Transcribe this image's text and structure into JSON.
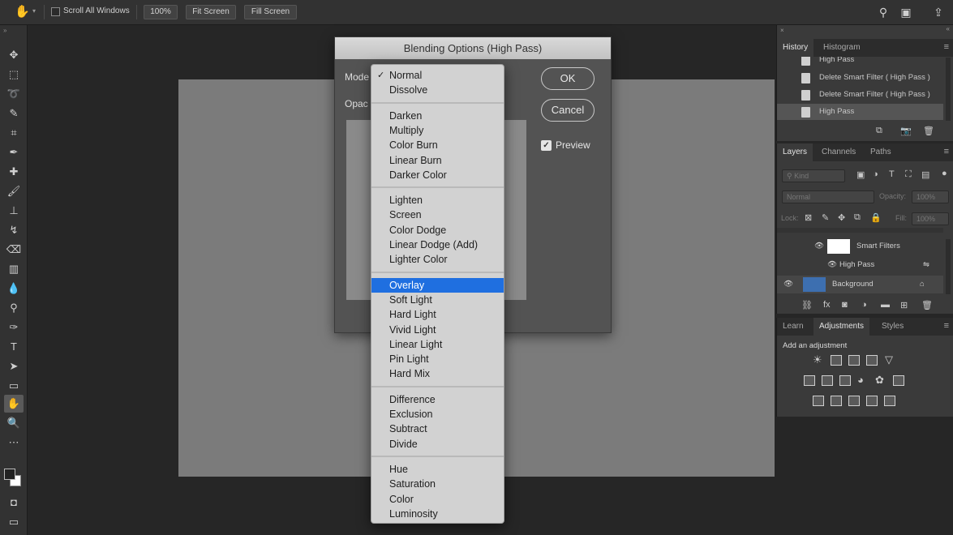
{
  "options_bar": {
    "scroll_all_windows_label": "Scroll All Windows",
    "zoom_value": "100%",
    "fit_screen_label": "Fit Screen",
    "fill_screen_label": "Fill Screen"
  },
  "dialog": {
    "title": "Blending Options (High Pass)",
    "mode_label": "Mode",
    "opacity_label": "Opac",
    "ok_label": "OK",
    "cancel_label": "Cancel",
    "preview_label": "Preview",
    "preview_checked": true
  },
  "blend_menu": {
    "selected": "Overlay",
    "checked": "Normal",
    "groups": [
      [
        "Normal",
        "Dissolve"
      ],
      [
        "Darken",
        "Multiply",
        "Color Burn",
        "Linear Burn",
        "Darker Color"
      ],
      [
        "Lighten",
        "Screen",
        "Color Dodge",
        "Linear Dodge (Add)",
        "Lighter Color"
      ],
      [
        "Overlay",
        "Soft Light",
        "Hard Light",
        "Vivid Light",
        "Linear Light",
        "Pin Light",
        "Hard Mix"
      ],
      [
        "Difference",
        "Exclusion",
        "Subtract",
        "Divide"
      ],
      [
        "Hue",
        "Saturation",
        "Color",
        "Luminosity"
      ]
    ]
  },
  "history_panel": {
    "tabs": [
      "History",
      "Histogram"
    ],
    "items": [
      "High Pass",
      "Delete Smart Filter ( High Pass )",
      "Delete Smart Filter ( High Pass )",
      "High Pass"
    ]
  },
  "layers_panel": {
    "tabs": [
      "Layers",
      "Channels",
      "Paths"
    ],
    "kind_placeholder": "Kind",
    "blend_mode": "Normal",
    "opacity_label": "Opacity:",
    "opacity_value": "100%",
    "lock_label": "Lock:",
    "fill_label": "Fill:",
    "fill_value": "100%",
    "smart_filters_label": "Smart Filters",
    "high_pass_label": "High Pass",
    "background_label": "Background"
  },
  "adjustments_panel": {
    "tabs": [
      "Learn",
      "Adjustments",
      "Styles"
    ],
    "add_label": "Add an adjustment"
  }
}
